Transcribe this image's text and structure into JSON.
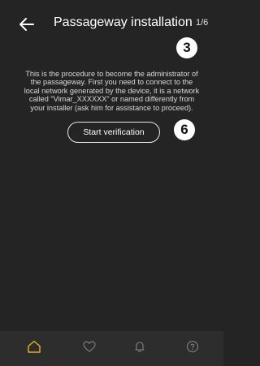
{
  "header": {
    "title": "Passageway installation",
    "step": "1/6",
    "back_icon": "arrow-left-icon"
  },
  "annotations": {
    "badge_3": "3",
    "badge_6": "6"
  },
  "main": {
    "description": "This is the procedure to become the administrator of the passageway. First you need to connect to the local network generated by the device, it is a network called \"Vimar_XXXXXX\" or named differently from your installer (ask him for assistance to proceed).",
    "start_button_label": "Start verification"
  },
  "bottom_nav": {
    "items": [
      {
        "icon": "home-icon",
        "active": true
      },
      {
        "icon": "heart-icon",
        "active": false
      },
      {
        "icon": "bell-icon",
        "active": false
      },
      {
        "icon": "help-icon",
        "active": false
      }
    ]
  },
  "colors": {
    "background": "#242424",
    "nav_background": "#2d2d2d",
    "accent": "#e8b21f",
    "inactive_icon": "#7a7a7a"
  }
}
